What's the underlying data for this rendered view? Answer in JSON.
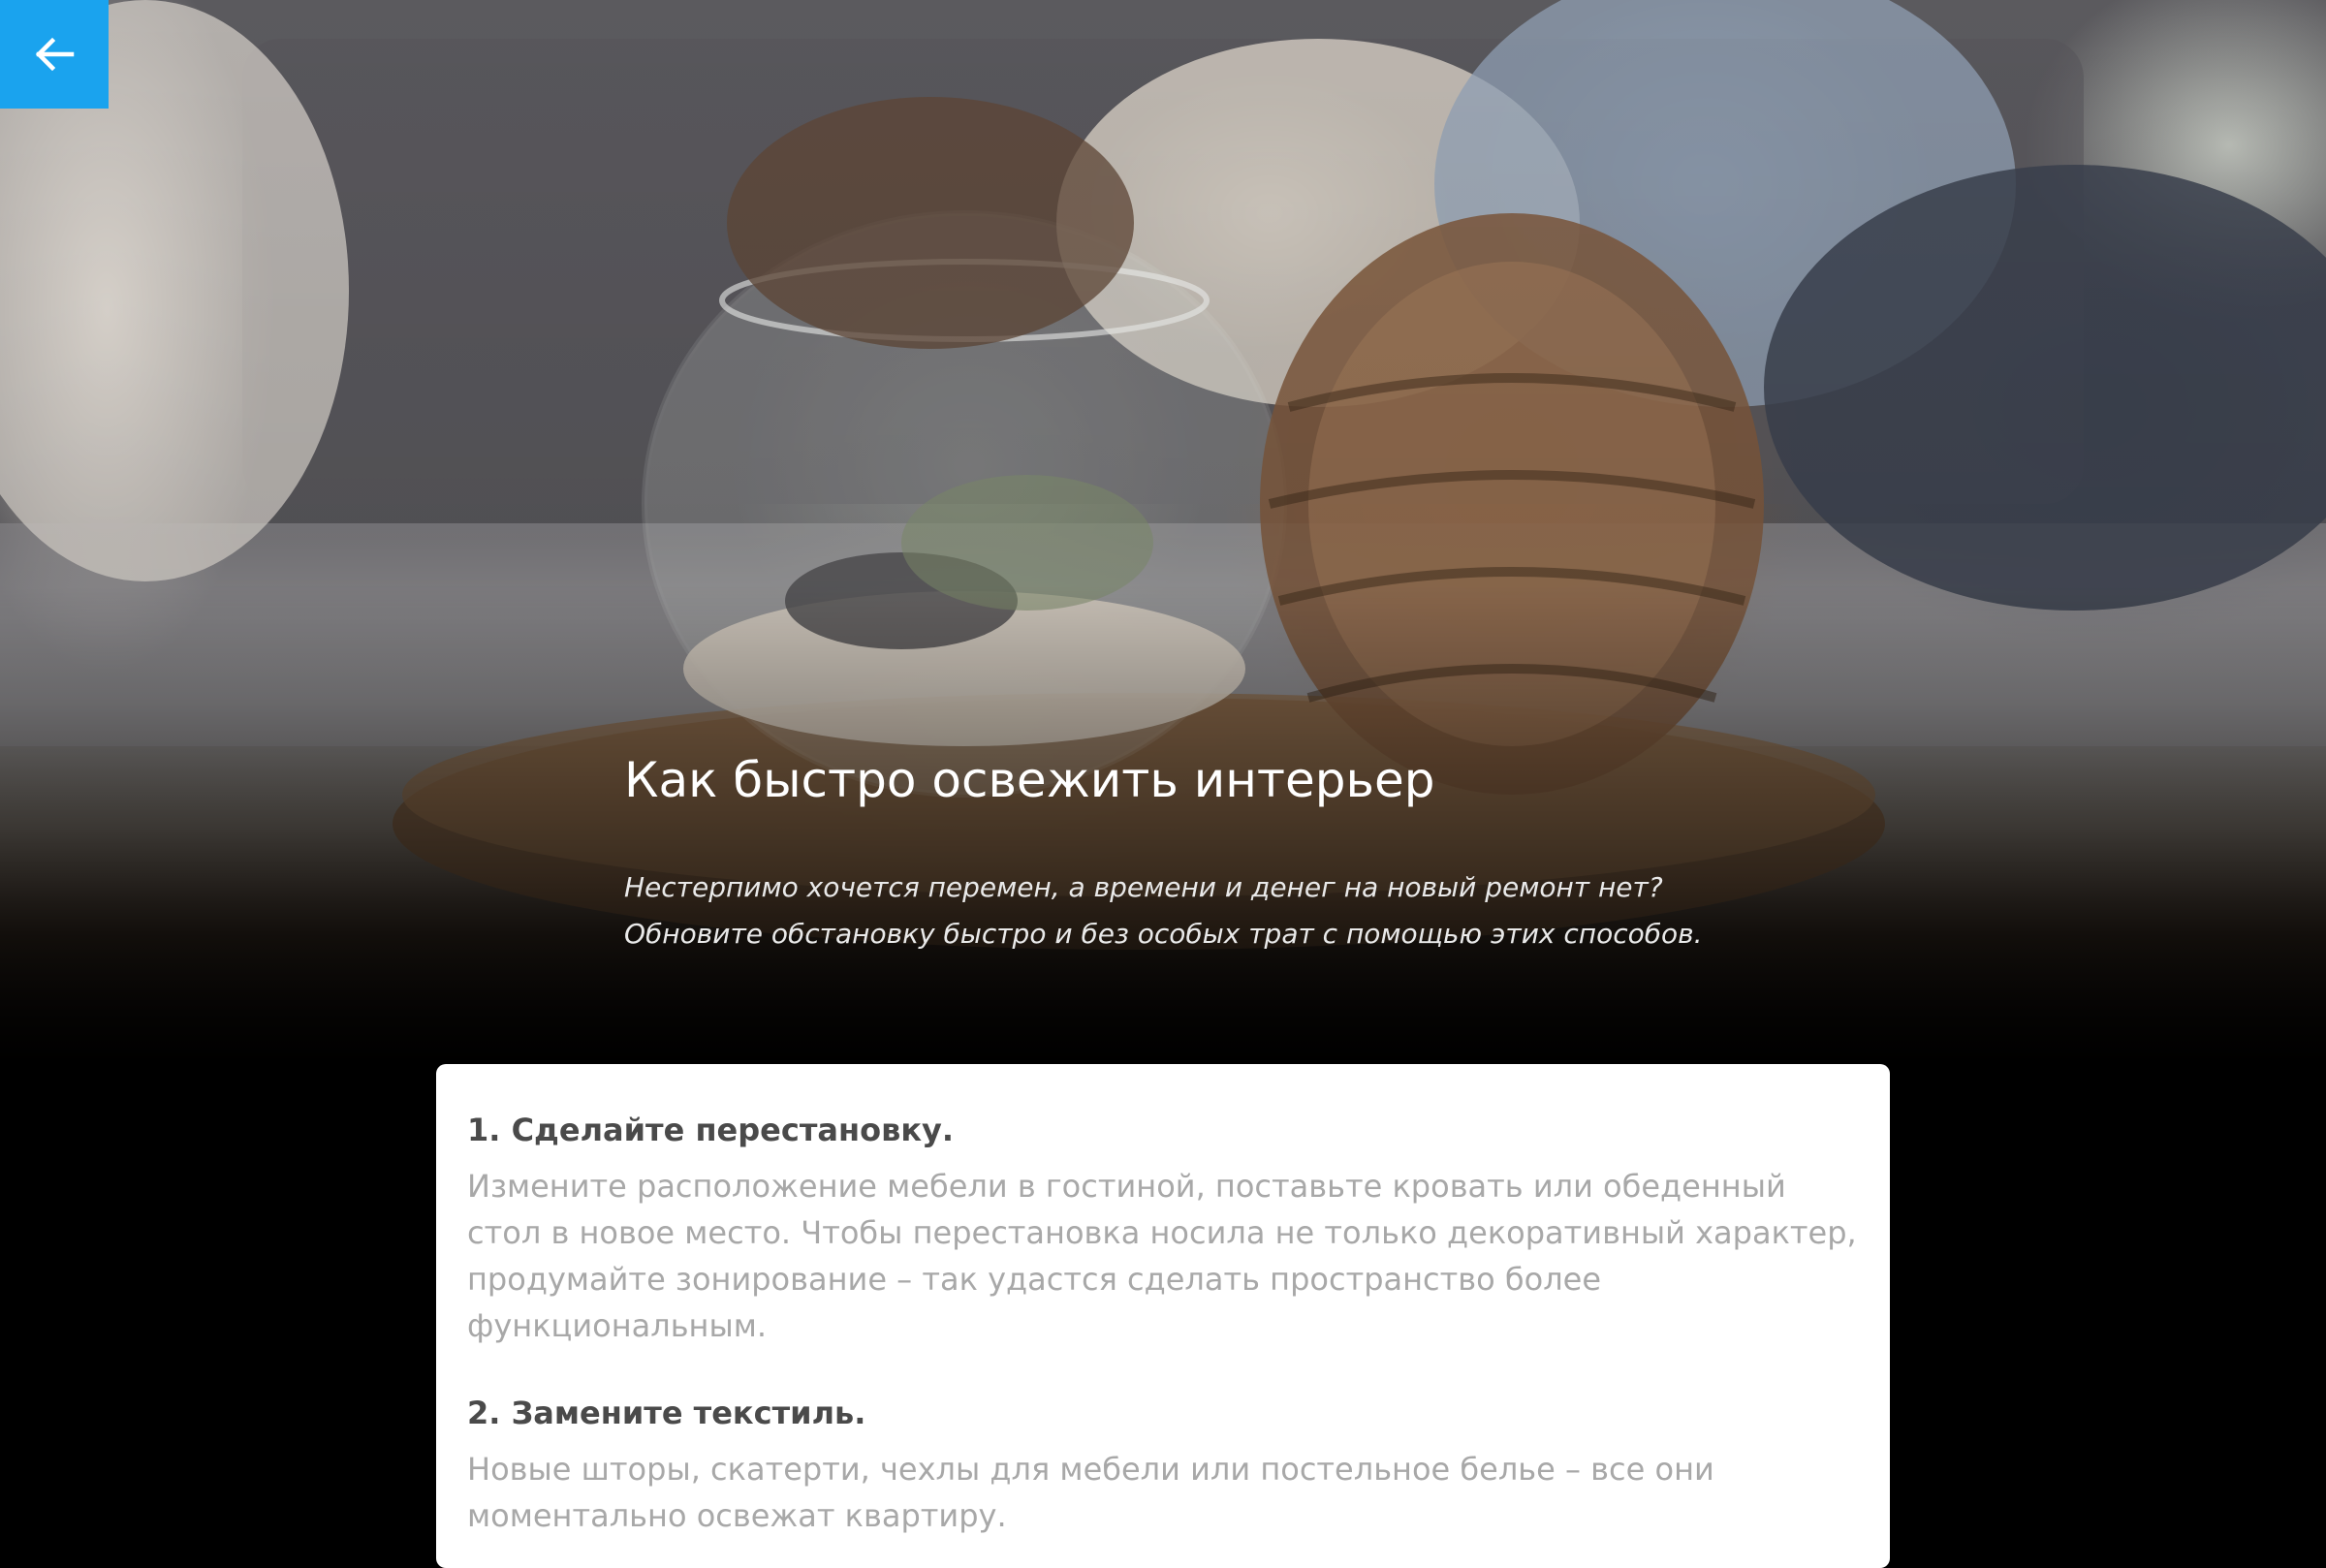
{
  "nav": {
    "back_icon": "arrow-left-icon",
    "accent": "#1aa3ee"
  },
  "hero": {
    "title": "Как быстро освежить интерьер",
    "lead_line1": "Нестерпимо хочется перемен, а времени и денег на новый ремонт нет?",
    "lead_line2": "Обновите обстановку быстро и без особых трат с помощью этих способов."
  },
  "article": {
    "steps": [
      {
        "heading": "1. Сделайте перестановку.",
        "body": "Измените расположение мебели в гостиной, поставьте кровать или обеденный стол в новое место. Чтобы перестановка носила не только декоративный характер, продумайте зонирование – так удастся сделать пространство более функциональным."
      },
      {
        "heading": "2. Замените текстиль.",
        "body": "Новые шторы, скатерти, чехлы для мебели или постельное белье – все они моментально освежат квартиру."
      }
    ]
  }
}
